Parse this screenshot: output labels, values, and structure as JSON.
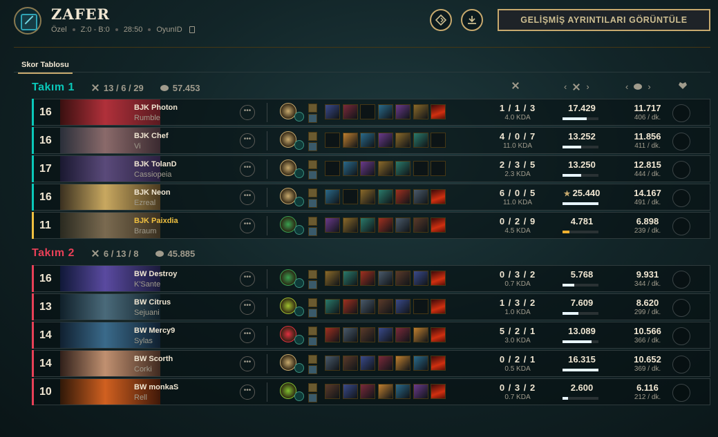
{
  "header": {
    "title": "ZAFER",
    "meta": {
      "queue": "Özel",
      "score": "Z:0 - B:0",
      "duration": "28:50",
      "game_id_label": "OyunID"
    },
    "advanced_button": "GELİŞMİŞ AYRINTILARI GÖRÜNTÜLE"
  },
  "tabs": [
    "Skor Tablosu"
  ],
  "team1": {
    "name": "Takım 1",
    "kda": "13 / 6 / 29",
    "gold": "57.453",
    "color": "#0ac8b9"
  },
  "team2": {
    "name": "Takım 2",
    "kda": "6 / 13 / 8",
    "gold": "45.885",
    "color": "#e84057"
  },
  "players": [
    {
      "level": "16",
      "name": "BJK Photon",
      "champion": "Rumble",
      "kda": "1 / 1 / 3",
      "ratio": "4.0 KDA",
      "damage": "17.429",
      "damage_pct": 0.68,
      "gold": "11.717",
      "gpm": "406 / dk.",
      "highlight": false,
      "star": false
    },
    {
      "level": "16",
      "name": "BJK Chef",
      "champion": "Vi",
      "kda": "4 / 0 / 7",
      "ratio": "11.0 KDA",
      "damage": "13.252",
      "damage_pct": 0.52,
      "gold": "11.856",
      "gpm": "411 / dk.",
      "highlight": false,
      "star": false
    },
    {
      "level": "17",
      "name": "BJK TolanD",
      "champion": "Cassiopeia",
      "kda": "2 / 3 / 5",
      "ratio": "2.3 KDA",
      "damage": "13.250",
      "damage_pct": 0.52,
      "gold": "12.815",
      "gpm": "444 / dk.",
      "highlight": false,
      "star": false
    },
    {
      "level": "16",
      "name": "BJK Neon",
      "champion": "Ezreal",
      "kda": "6 / 0 / 5",
      "ratio": "11.0 KDA",
      "damage": "25.440",
      "damage_pct": 1.0,
      "gold": "14.167",
      "gpm": "491 / dk.",
      "highlight": false,
      "star": true
    },
    {
      "level": "11",
      "name": "BJK Paixdia",
      "champion": "Braum",
      "kda": "0 / 2 / 9",
      "ratio": "4.5 KDA",
      "damage": "4.781",
      "damage_pct": 0.19,
      "gold": "6.898",
      "gpm": "239 / dk.",
      "highlight": true,
      "star": false
    },
    {
      "level": "16",
      "name": "BW Destroy",
      "champion": "K'Sante",
      "kda": "0 / 3 / 2",
      "ratio": "0.7 KDA",
      "damage": "5.768",
      "damage_pct": 0.33,
      "gold": "9.931",
      "gpm": "344 / dk.",
      "highlight": false,
      "star": false
    },
    {
      "level": "13",
      "name": "BW Citrus",
      "champion": "Sejuani",
      "kda": "1 / 3 / 2",
      "ratio": "1.0 KDA",
      "damage": "7.609",
      "damage_pct": 0.44,
      "gold": "8.620",
      "gpm": "299 / dk.",
      "highlight": false,
      "star": false
    },
    {
      "level": "14",
      "name": "BW Mercy9",
      "champion": "Sylas",
      "kda": "5 / 2 / 1",
      "ratio": "3.0 KDA",
      "damage": "13.089",
      "damage_pct": 0.8,
      "gold": "10.566",
      "gpm": "366 / dk.",
      "highlight": false,
      "star": false
    },
    {
      "level": "14",
      "name": "BW Scorth",
      "champion": "Corki",
      "kda": "0 / 2 / 1",
      "ratio": "0.5 KDA",
      "damage": "16.315",
      "damage_pct": 1.0,
      "gold": "10.652",
      "gpm": "369 / dk.",
      "highlight": false,
      "star": false
    },
    {
      "level": "10",
      "name": "BW monkaS",
      "champion": "Rell",
      "kda": "0 / 3 / 2",
      "ratio": "0.7 KDA",
      "damage": "2.600",
      "damage_pct": 0.16,
      "gold": "6.116",
      "gpm": "212 / dk.",
      "highlight": false,
      "star": false
    }
  ]
}
